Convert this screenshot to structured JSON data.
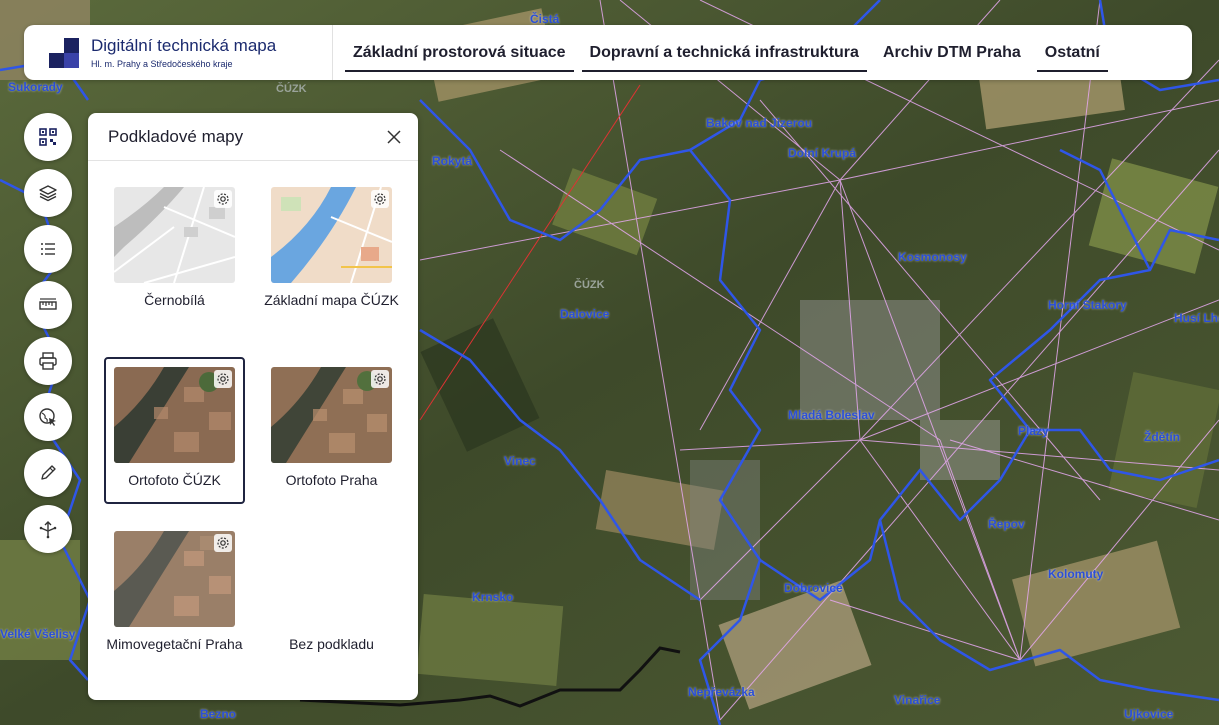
{
  "header": {
    "brand_title": "Digitální technická mapa",
    "brand_subtitle": "Hl. m. Prahy a Středočeského kraje",
    "tabs": [
      {
        "label": "Základní prostorová situace"
      },
      {
        "label": "Dopravní a technická infrastruktura"
      },
      {
        "label": "Archiv DTM Praha"
      },
      {
        "label": "Ostatní"
      }
    ]
  },
  "toolbar": {
    "buttons": [
      {
        "icon": "qr-grid-icon"
      },
      {
        "icon": "layers-icon"
      },
      {
        "icon": "list-icon"
      },
      {
        "icon": "ruler-icon"
      },
      {
        "icon": "printer-icon"
      },
      {
        "icon": "globe-cursor-icon"
      },
      {
        "icon": "pencil-icon"
      },
      {
        "icon": "share-nodes-icon"
      }
    ]
  },
  "basemap_panel": {
    "title": "Podkladové mapy",
    "options": [
      {
        "label": "Černobílá",
        "selected": false,
        "has_settings": true
      },
      {
        "label": "Základní mapa ČÚZK",
        "selected": false,
        "has_settings": true
      },
      {
        "label": "Ortofoto ČÚZK",
        "selected": true,
        "has_settings": true
      },
      {
        "label": "Ortofoto Praha",
        "selected": false,
        "has_settings": true
      },
      {
        "label": "Mimovegetační Praha",
        "selected": false,
        "has_settings": true
      },
      {
        "label": "Bez podkladu",
        "selected": false,
        "has_settings": false
      }
    ]
  },
  "map": {
    "places": [
      {
        "name": "Čistá"
      },
      {
        "name": "Sukorady"
      },
      {
        "name": "ČÚZK"
      },
      {
        "name": "Bakov nad Jizerou"
      },
      {
        "name": "Dolní Krupá"
      },
      {
        "name": "Rokytá"
      },
      {
        "name": "Kosmonosy"
      },
      {
        "name": "Dalovice"
      },
      {
        "name": "ČÚZK"
      },
      {
        "name": "Horní Stakory"
      },
      {
        "name": "Husí Lhota"
      },
      {
        "name": "Mladá Boleslav"
      },
      {
        "name": "Plazy"
      },
      {
        "name": "Ždětín"
      },
      {
        "name": "Vinec"
      },
      {
        "name": "Řepov"
      },
      {
        "name": "Kolomuty"
      },
      {
        "name": "Dobrovice"
      },
      {
        "name": "Krnsko"
      },
      {
        "name": "Velké Všelisy"
      },
      {
        "name": "Nepřevázka"
      },
      {
        "name": "Vinařice"
      },
      {
        "name": "Bezno"
      },
      {
        "name": "Ujkovice"
      }
    ]
  }
}
